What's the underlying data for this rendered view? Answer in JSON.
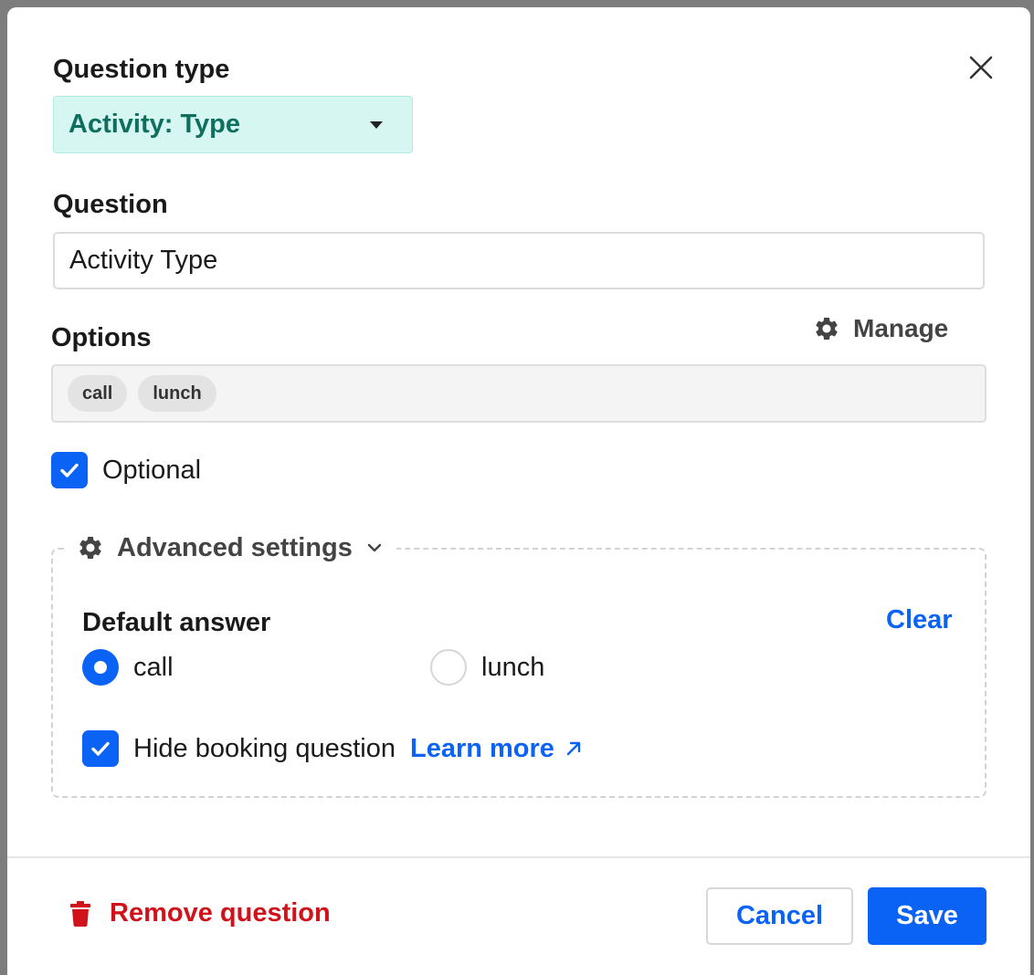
{
  "colors": {
    "accent": "#0b63f6",
    "select_bg": "#d6f7f1",
    "select_text": "#0f6e5d",
    "danger": "#d0121b"
  },
  "question_type": {
    "label": "Question type",
    "selected": "Activity: Type",
    "icon": "caret-down-icon"
  },
  "question": {
    "label": "Question",
    "value": "Activity Type"
  },
  "options": {
    "label": "Options",
    "manage_label": "Manage",
    "manage_icon": "gear-icon",
    "chips": [
      "call",
      "lunch"
    ]
  },
  "optional": {
    "label": "Optional",
    "checked": true
  },
  "advanced": {
    "title": "Advanced settings",
    "icon": "gear-icon",
    "toggle_icon": "chevron-down-icon",
    "default_answer": {
      "label": "Default answer",
      "clear_label": "Clear",
      "choices": [
        {
          "label": "call",
          "selected": true
        },
        {
          "label": "lunch",
          "selected": false
        }
      ]
    },
    "hide_booking": {
      "label": "Hide booking question",
      "checked": true,
      "learn_more": "Learn more",
      "learn_more_icon": "external-link-icon"
    }
  },
  "footer": {
    "remove_label": "Remove question",
    "remove_icon": "trash-icon",
    "cancel_label": "Cancel",
    "save_label": "Save"
  },
  "close_icon": "close-icon"
}
